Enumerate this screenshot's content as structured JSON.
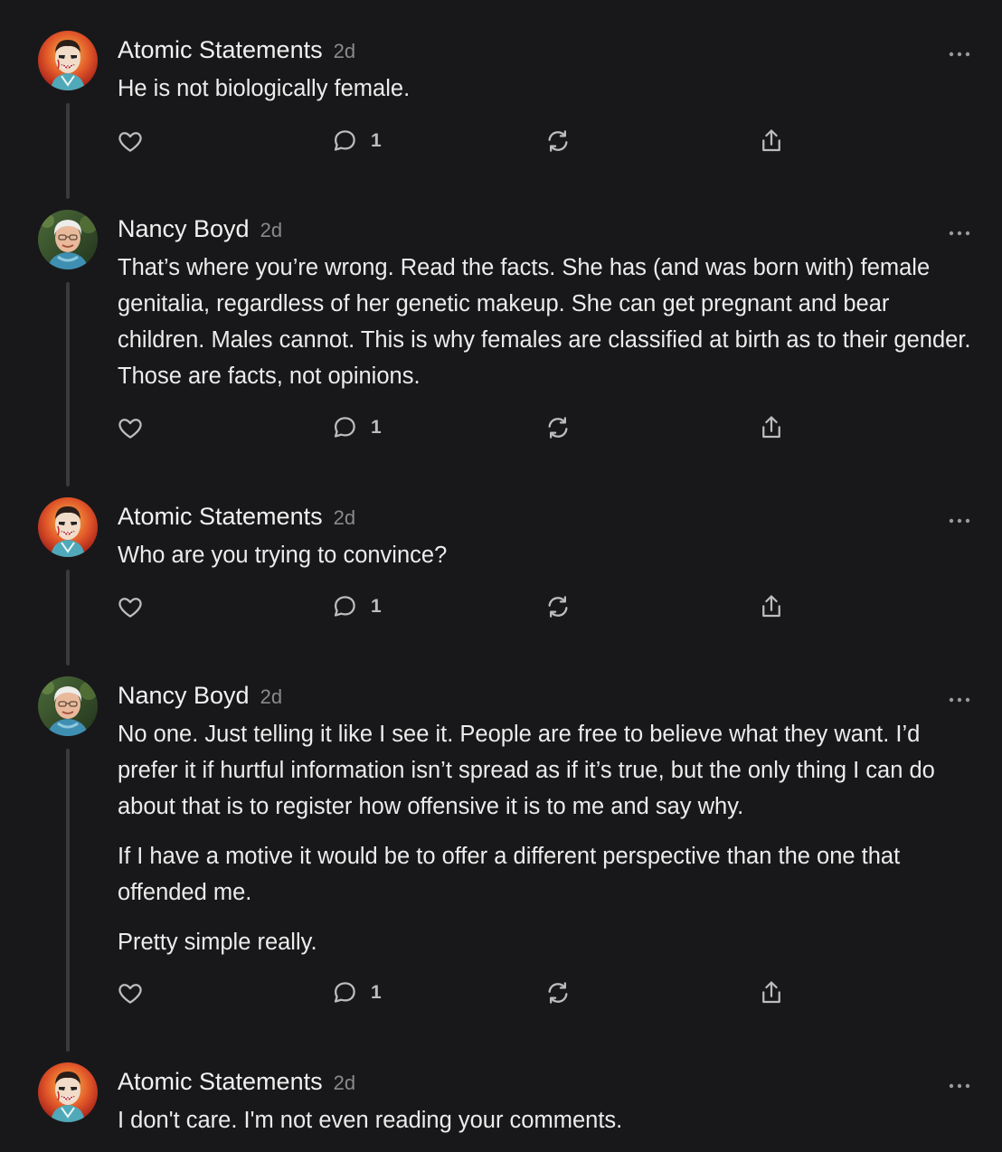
{
  "comments": [
    {
      "author": "Atomic Statements",
      "time": "2d",
      "avatar": "avatar-atomic",
      "paragraphs": [
        "He is not biologically female."
      ],
      "reply_count": "1"
    },
    {
      "author": "Nancy Boyd",
      "time": "2d",
      "avatar": "avatar-nancy",
      "paragraphs": [
        "That’s where you’re wrong. Read the facts. She has (and was born with) female genitalia, regardless of her genetic makeup. She can get pregnant and bear children. Males cannot. This is why females are classified at birth as to their gender. Those are facts, not opinions."
      ],
      "reply_count": "1"
    },
    {
      "author": "Atomic Statements",
      "time": "2d",
      "avatar": "avatar-atomic",
      "paragraphs": [
        "Who are you trying to convince?"
      ],
      "reply_count": "1"
    },
    {
      "author": "Nancy Boyd",
      "time": "2d",
      "avatar": "avatar-nancy",
      "paragraphs": [
        "No one. Just telling it like I see it. People are free to believe what they want. I’d prefer it if hurtful information isn’t spread as if it’s true, but the only thing I can do about that is to register how offensive it is to me and say why.",
        "If I have a motive it would be to offer a different perspective than the one that offended me.",
        "Pretty simple really."
      ],
      "reply_count": "1"
    },
    {
      "author": "Atomic Statements",
      "time": "2d",
      "avatar": "avatar-atomic",
      "paragraphs": [
        "I don't care. I'm not even reading your comments."
      ],
      "reply_count": ""
    }
  ],
  "icons": {
    "like": "heart-icon",
    "reply": "speech-bubble-icon",
    "restack": "restack-arrows-icon",
    "share": "share-upload-icon",
    "more": "more-dots-icon"
  },
  "colors": {
    "background": "#18181a",
    "text": "#ececec",
    "muted": "#8a8a8e",
    "icon": "#bdbdc1",
    "thread_line": "#3a3a3d"
  }
}
